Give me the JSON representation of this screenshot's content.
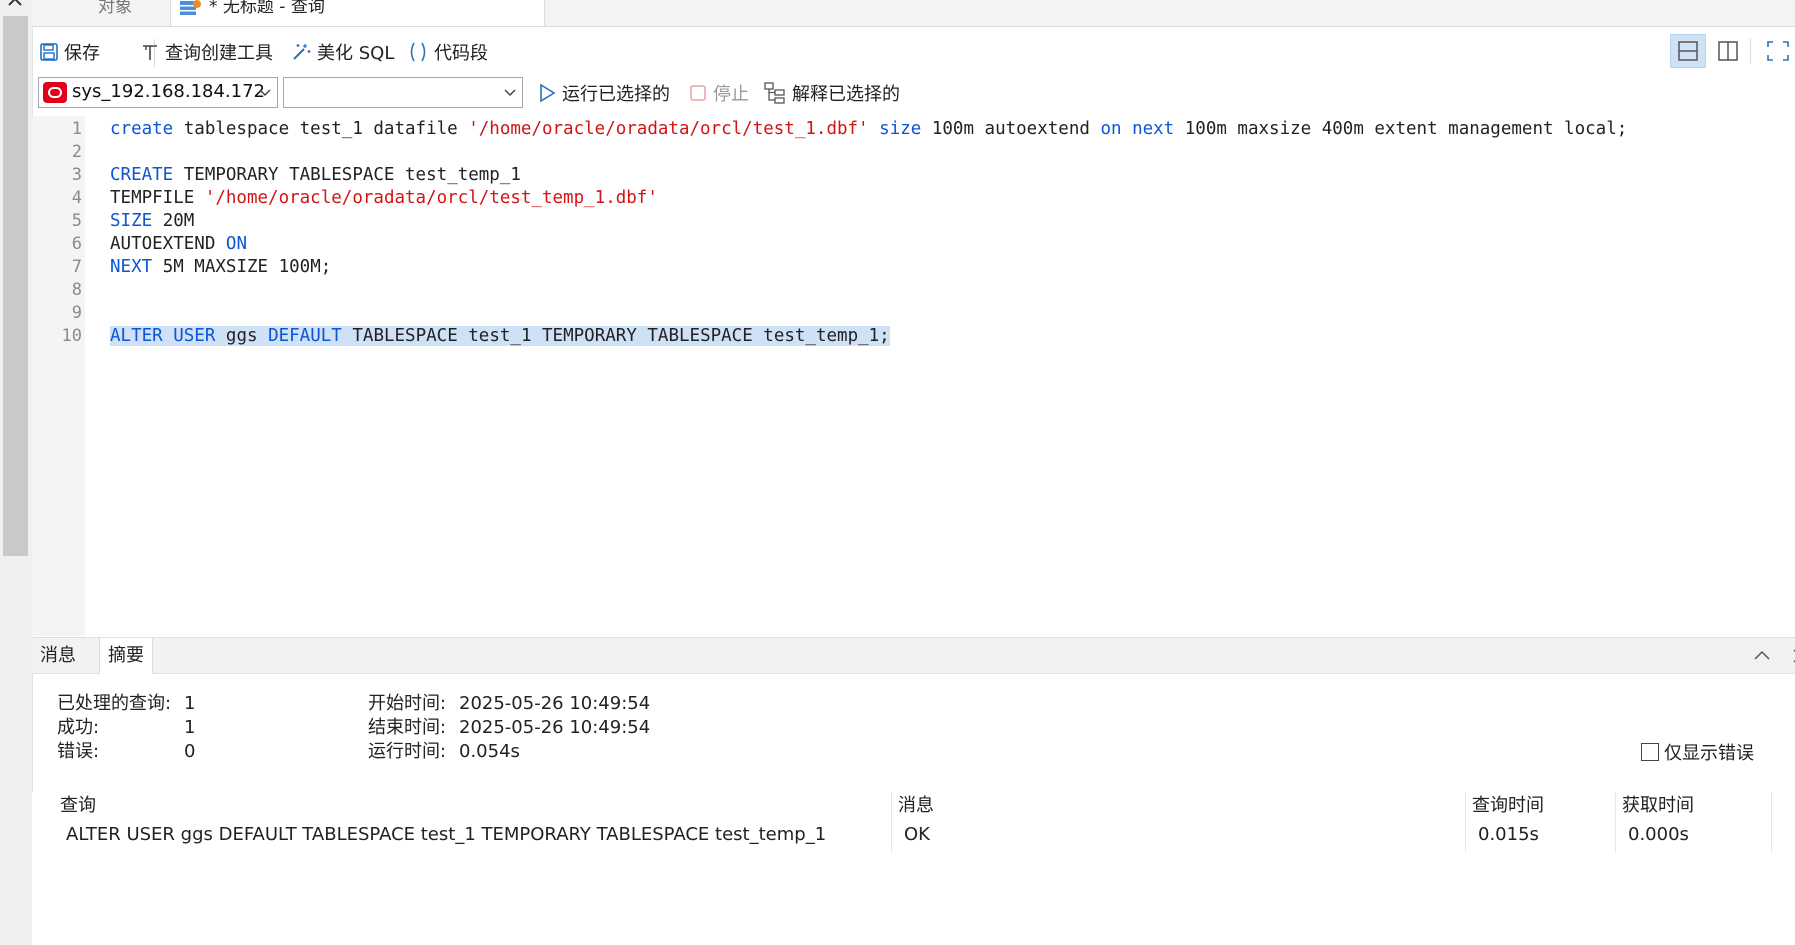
{
  "tabs": {
    "objects": "对象",
    "query": "* 无标题 - 查询"
  },
  "toolbar": {
    "save": "保存",
    "query_builder": "查询创建工具",
    "beautify": "美化 SQL",
    "snippet": "代码段",
    "connection": "sys_192.168.184.172",
    "database": "",
    "run_selected": "运行已选择的",
    "stop": "停止",
    "explain_selected": "解释已选择的"
  },
  "editor": {
    "line_numbers": [
      "1",
      "2",
      "3",
      "4",
      "5",
      "6",
      "7",
      "8",
      "9",
      "10"
    ],
    "lines": [
      [
        {
          "t": "create",
          "c": "kw"
        },
        {
          "t": " tablespace test_1 datafile "
        },
        {
          "t": "'/home/oracle/oradata/orcl/test_1.dbf'",
          "c": "str"
        },
        {
          "t": " "
        },
        {
          "t": "size",
          "c": "kw"
        },
        {
          "t": " 100m autoextend "
        },
        {
          "t": "on",
          "c": "kw"
        },
        {
          "t": " "
        },
        {
          "t": "next",
          "c": "kw"
        },
        {
          "t": " 100m maxsize 400m extent management local;"
        }
      ],
      [],
      [
        {
          "t": "CREATE",
          "c": "kw"
        },
        {
          "t": " TEMPORARY TABLESPACE test_temp_1"
        }
      ],
      [
        {
          "t": "TEMPFILE "
        },
        {
          "t": "'/home/oracle/oradata/orcl/test_temp_1.dbf'",
          "c": "str"
        }
      ],
      [
        {
          "t": "SIZE",
          "c": "kw"
        },
        {
          "t": " 20M"
        }
      ],
      [
        {
          "t": "AUTOEXTEND "
        },
        {
          "t": "ON",
          "c": "kw"
        }
      ],
      [
        {
          "t": "NEXT",
          "c": "kw"
        },
        {
          "t": " 5M MAXSIZE 100M;"
        }
      ],
      [],
      [],
      [
        {
          "t": "ALTER",
          "c": "kw"
        },
        {
          "t": " "
        },
        {
          "t": "USER",
          "c": "kw"
        },
        {
          "t": " ggs "
        },
        {
          "t": "DEFAULT",
          "c": "kw"
        },
        {
          "t": " TABLESPACE test_1 TEMPORARY TABLESPACE test_temp_1;"
        }
      ]
    ],
    "selected_line": 10
  },
  "results": {
    "tab_messages": "消息",
    "tab_summary": "摘要",
    "summary": {
      "processed_label": "已处理的查询:",
      "processed_value": "1",
      "success_label": "成功:",
      "success_value": "1",
      "error_label": "错误:",
      "error_value": "0",
      "start_label": "开始时间:",
      "start_value": "2025-05-26 10:49:54",
      "end_label": "结束时间:",
      "end_value": "2025-05-26 10:49:54",
      "elapsed_label": "运行时间:",
      "elapsed_value": "0.054s"
    },
    "only_errors": "仅显示错误",
    "columns": [
      "查询",
      "消息",
      "查询时间",
      "获取时间"
    ],
    "rows": [
      [
        "ALTER USER ggs DEFAULT TABLESPACE test_1 TEMPORARY TABLESPACE test_temp_1",
        "OK",
        "0.015s",
        "0.000s"
      ]
    ]
  },
  "colors": {
    "keyword": "#0b55d6",
    "string": "#d21414",
    "selection": "#cfe1f6",
    "oracle_red": "#e0001a"
  }
}
